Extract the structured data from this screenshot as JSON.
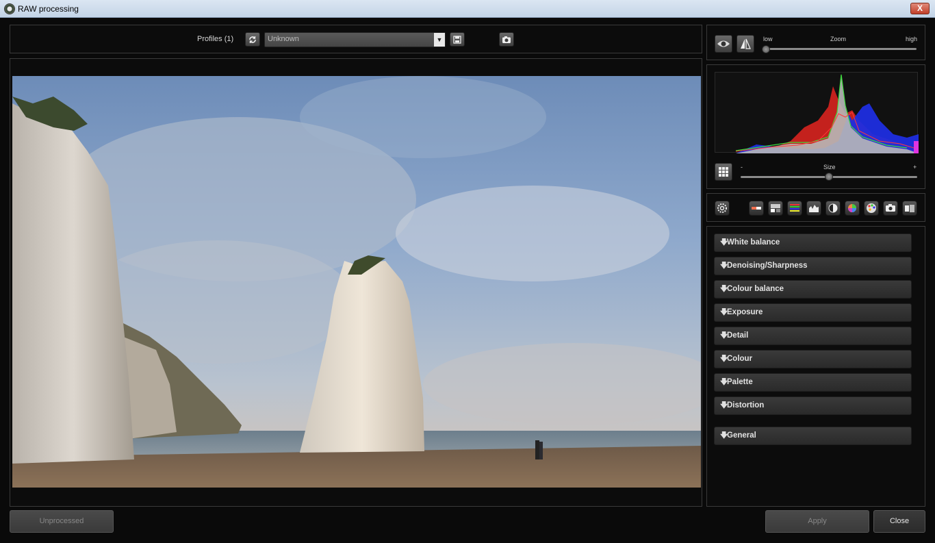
{
  "window": {
    "title": "RAW processing",
    "close_glyph": "X"
  },
  "toolbar": {
    "profiles_label": "Profiles (1)",
    "profile_value": "Unknown",
    "select_arrow": "▼"
  },
  "zoom": {
    "low_label": "low",
    "title": "Zoom",
    "high_label": "high",
    "value": 0
  },
  "histogram": {
    "size_minus": "-",
    "size_label": "Size",
    "size_plus": "+",
    "size_value": 0.5
  },
  "sections": [
    "White balance",
    "Denoising/Sharpness",
    "Colour balance",
    "Exposure",
    "Detail",
    "Colour",
    "Palette",
    "Distortion",
    "General"
  ],
  "icons": {
    "refresh": "refresh-icon",
    "save": "save-icon",
    "camera": "camera-icon",
    "eye": "eye-icon",
    "compare": "compare-icon",
    "grid": "grid-icon",
    "settings": "gear-icon"
  },
  "buttons": {
    "unprocessed": "Unprocessed",
    "apply": "Apply",
    "close": "Close"
  },
  "colors": {
    "accent_red": "#d8231f",
    "accent_blue": "#1f2ee0",
    "accent_green": "#3fdc3f"
  }
}
